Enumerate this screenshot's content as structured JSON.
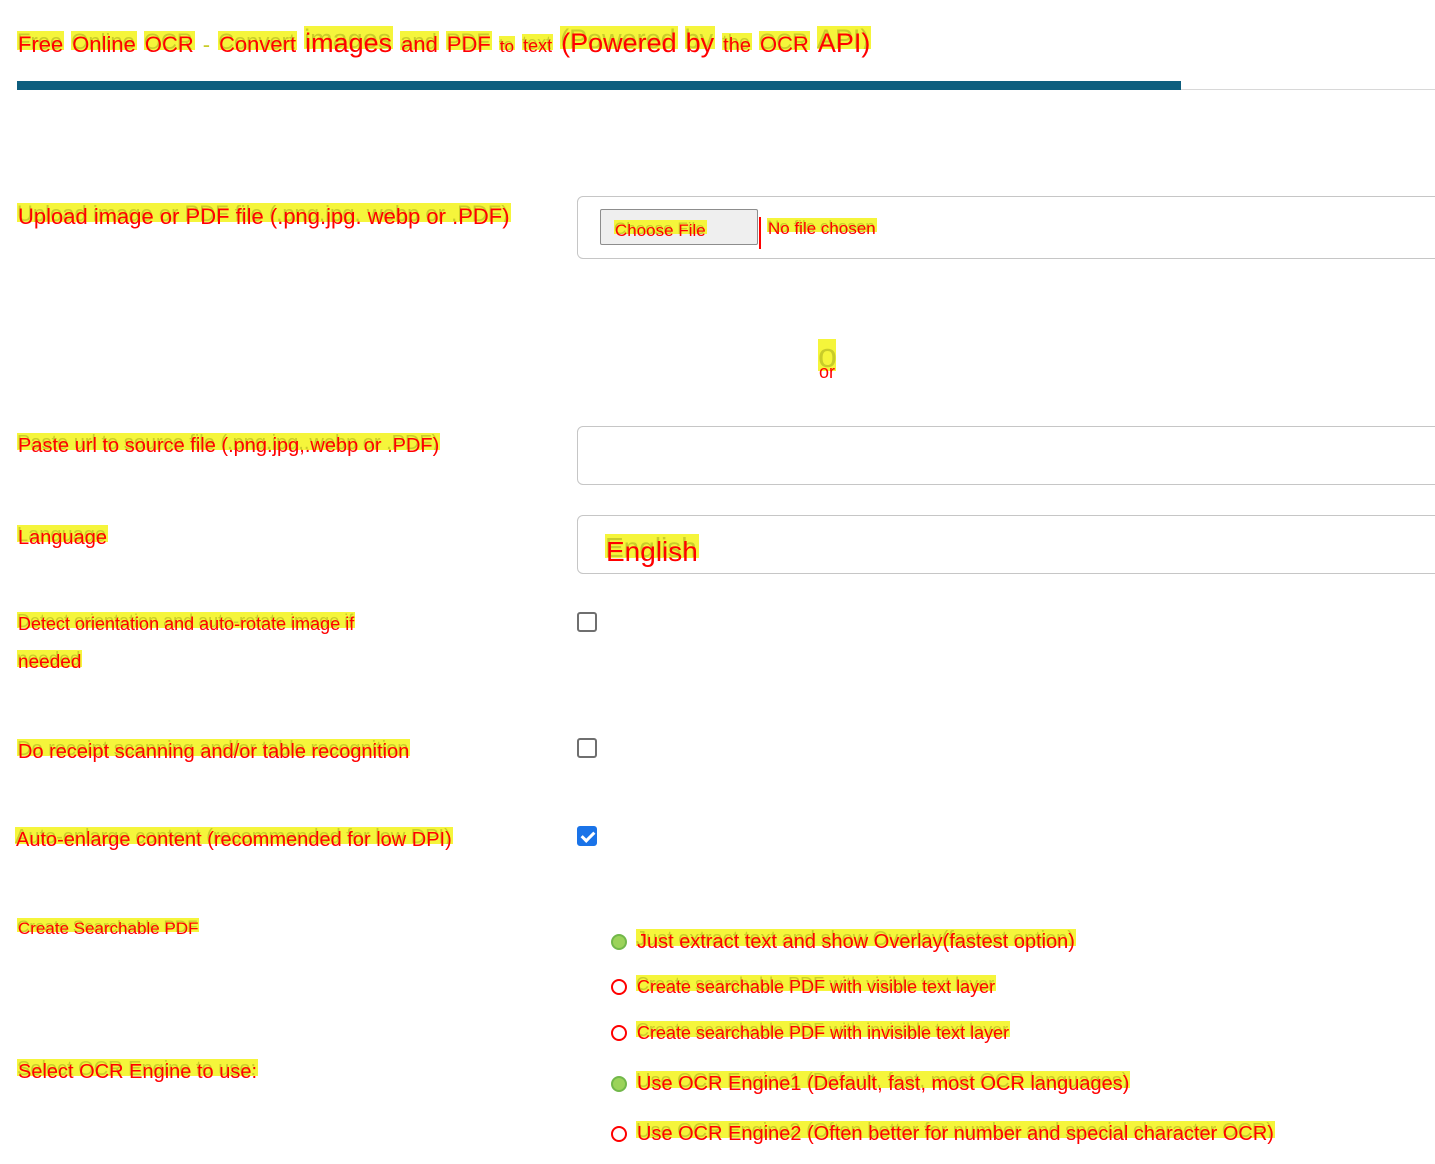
{
  "page": {
    "title_words": [
      "Free",
      "Online",
      "OCR",
      "-",
      "Convert",
      "images",
      "and",
      "PDF",
      "to",
      "text",
      "(Powered",
      "by",
      "the",
      "OCR",
      "API)"
    ]
  },
  "form": {
    "upload": {
      "label": "Upload image or PDF file (.png.jpg. webp or .PDF)",
      "button_label": "Choose File",
      "status": "No file chosen"
    },
    "separator": "or",
    "url": {
      "label": "Paste url to source file (.png.jpg,.webp or .PDF)",
      "value": ""
    },
    "language": {
      "label": "Language",
      "selected": "English"
    },
    "detect_orientation": {
      "label_line1": "Detect orientation and auto-rotate image if",
      "label_line2": "needed",
      "checked": false
    },
    "receipt_scanning": {
      "label": "Do receipt scanning and/or table recognition",
      "checked": false
    },
    "auto_enlarge": {
      "label": "Auto-enlarge content (recommended for low DPI)",
      "checked": true
    },
    "searchable_pdf": {
      "label": "Create Searchable PDF",
      "options": [
        {
          "label": "Just extract text and show Overlay(fastest option)",
          "selected": true
        },
        {
          "label": "Create searchable PDF with visible text layer",
          "selected": false
        },
        {
          "label": "Create searchable PDF with invisible text layer",
          "selected": false
        }
      ]
    },
    "ocr_engine": {
      "label": "Select OCR Engine to use:",
      "options": [
        {
          "label": "Use OCR Engine1 (Default, fast, most OCR languages)",
          "selected": true
        },
        {
          "label": "Use OCR Engine2 (Often better for number and special character OCR)",
          "selected": false
        }
      ]
    }
  },
  "colors": {
    "accent_underline": "#0e5e7e",
    "overlay_text": "#ff0000",
    "overlay_highlight": "#f5f53b",
    "checkbox_checked": "#1a73e8"
  }
}
